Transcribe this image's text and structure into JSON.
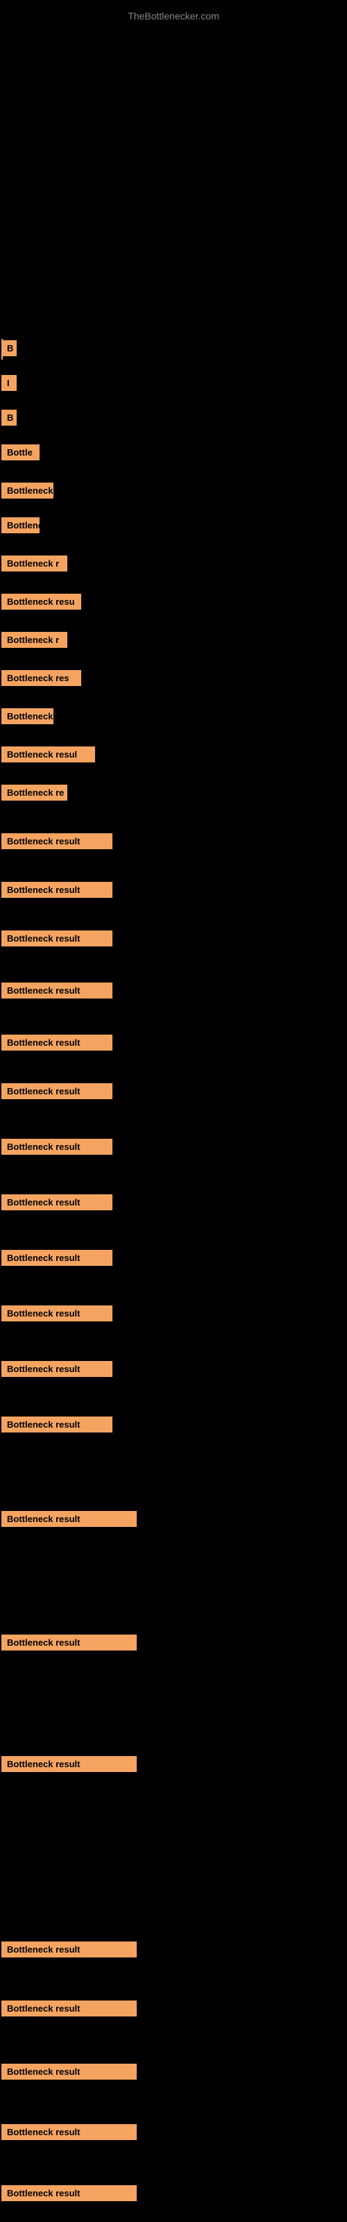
{
  "site": {
    "title": "TheBottlenecker.com"
  },
  "rows": [
    {
      "id": "row-1",
      "label": "B",
      "width_class": "w-tiny"
    },
    {
      "id": "row-2",
      "label": "I",
      "width_class": "w-tiny"
    },
    {
      "id": "row-3",
      "label": "B",
      "width_class": "w-tiny"
    },
    {
      "id": "row-4",
      "label": "Bottle",
      "width_class": "w-medium-s"
    },
    {
      "id": "row-5",
      "label": "Bottleneck",
      "width_class": "w-medium"
    },
    {
      "id": "row-6",
      "label": "Bottlene",
      "width_class": "w-medium-s"
    },
    {
      "id": "row-7",
      "label": "Bottleneck r",
      "width_class": "w-medium-l"
    },
    {
      "id": "row-8",
      "label": "Bottleneck resu",
      "width_class": "w-large"
    },
    {
      "id": "row-9",
      "label": "Bottleneck r",
      "width_class": "w-medium-l"
    },
    {
      "id": "row-10",
      "label": "Bottleneck res",
      "width_class": "w-large"
    },
    {
      "id": "row-11",
      "label": "Bottleneck",
      "width_class": "w-medium"
    },
    {
      "id": "row-12",
      "label": "Bottleneck resul",
      "width_class": "w-larger"
    },
    {
      "id": "row-13",
      "label": "Bottleneck re",
      "width_class": "w-medium-l"
    },
    {
      "id": "row-14",
      "label": "Bottleneck result",
      "width_class": "w-xlarge"
    },
    {
      "id": "row-15",
      "label": "Bottleneck result",
      "width_class": "w-xlarge"
    },
    {
      "id": "row-16",
      "label": "Bottleneck result",
      "width_class": "w-xlarge"
    },
    {
      "id": "row-17",
      "label": "Bottleneck result",
      "width_class": "w-xlarge"
    },
    {
      "id": "row-18",
      "label": "Bottleneck result",
      "width_class": "w-xlarge"
    },
    {
      "id": "row-19",
      "label": "Bottleneck result",
      "width_class": "w-xlarge"
    },
    {
      "id": "row-20",
      "label": "Bottleneck result",
      "width_class": "w-xlarge"
    },
    {
      "id": "row-21",
      "label": "Bottleneck result",
      "width_class": "w-xlarge"
    },
    {
      "id": "row-22",
      "label": "Bottleneck result",
      "width_class": "w-xlarge"
    },
    {
      "id": "row-23",
      "label": "Bottleneck result",
      "width_class": "w-xlarge"
    },
    {
      "id": "row-24",
      "label": "Bottleneck result",
      "width_class": "w-xlarge"
    },
    {
      "id": "row-25",
      "label": "Bottleneck result",
      "width_class": "w-xlarge"
    },
    {
      "id": "row-det-1",
      "label": "Bottleneck result",
      "width_class": "w-full"
    },
    {
      "id": "row-det-2",
      "label": "Bottleneck result",
      "width_class": "w-full"
    },
    {
      "id": "row-det-3",
      "label": "Bottleneck result",
      "width_class": "w-full"
    },
    {
      "id": "row-det-4",
      "label": "Bottleneck result",
      "width_class": "w-full"
    },
    {
      "id": "row-det-5",
      "label": "Bottleneck result",
      "width_class": "w-full"
    },
    {
      "id": "row-det-6",
      "label": "Bottleneck result",
      "width_class": "w-full"
    },
    {
      "id": "row-det-7",
      "label": "Bottleneck result",
      "width_class": "w-full"
    },
    {
      "id": "row-det-8",
      "label": "Bottleneck result",
      "width_class": "w-full"
    }
  ],
  "row_positions": {
    "row-1": 490,
    "row-2": 540,
    "row-3": 590,
    "row-4": 640,
    "row-5": 695,
    "row-6": 745,
    "row-7": 800,
    "row-8": 855,
    "row-9": 910,
    "row-10": 965,
    "row-11": 1020,
    "row-12": 1075,
    "row-13": 1130,
    "row-14": 1200,
    "row-15": 1270,
    "row-16": 1340,
    "row-17": 1415,
    "row-18": 1490,
    "row-19": 1560,
    "row-20": 1640,
    "row-21": 1720,
    "row-22": 1800,
    "row-23": 1880,
    "row-24": 1960,
    "row-25": 2040,
    "row-det-1": 2176,
    "row-det-2": 2354,
    "row-det-3": 2529,
    "row-det-4": 2796,
    "row-det-5": 2881,
    "row-det-6": 2972,
    "row-det-7": 3059,
    "row-det-8": 3147
  }
}
